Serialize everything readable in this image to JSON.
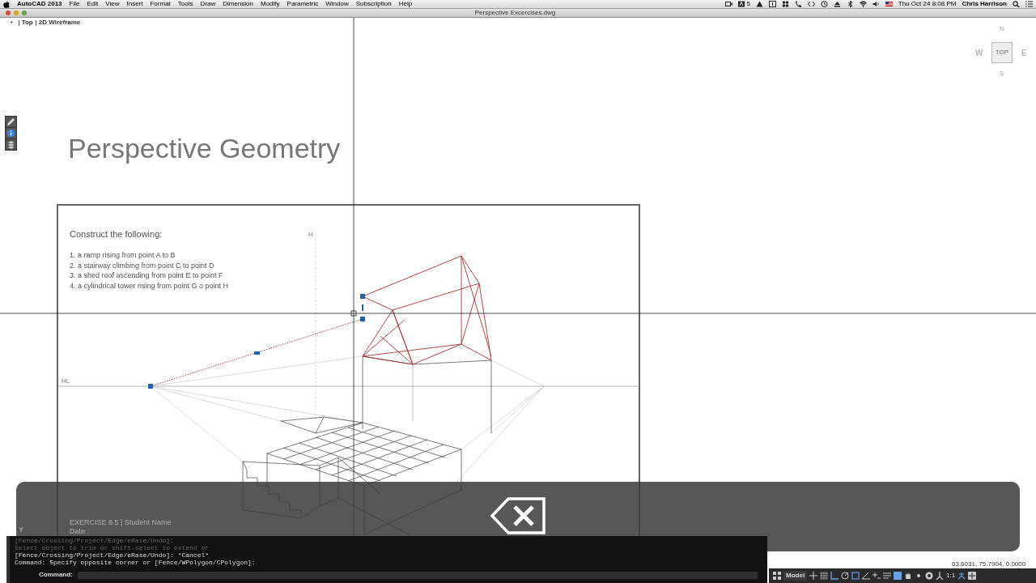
{
  "menu_bar": {
    "app": "AutoCAD 2013",
    "items": [
      "File",
      "Edit",
      "View",
      "Insert",
      "Format",
      "Tools",
      "Draw",
      "Dimension",
      "Modify",
      "Parametric",
      "Window",
      "Subscription",
      "Help"
    ],
    "adobe_count": "5",
    "clock": "Thu Oct 24  8:08 PM",
    "user": "Chris Harrison"
  },
  "window": {
    "title": "Perspective Excercises.dwg"
  },
  "viewport_controls": [
    "+",
    "Top",
    "2D Wireframe"
  ],
  "view_cube": {
    "north": "N",
    "west": "W",
    "face": "TOP",
    "east": "E",
    "south": "S"
  },
  "sheet": {
    "title": "Perspective Geometry",
    "heading": "Construct the following:",
    "tasks": [
      "1. a ramp rising from point A to B",
      "2. a stairway climbing from point C to point D",
      "3. a shed roof ascending from point E to point F",
      "4. a cylindrical tower rising from point G o point H"
    ],
    "horizon_label": "HL",
    "height_label": "H",
    "footer": [
      "EXERCISE 8.5 | Student Name",
      "Date"
    ]
  },
  "ucs_label": "Y",
  "command_line": {
    "history": [
      "[Fence/Crossing/Project/Edge/eRase/Undo]:",
      "Select object to trim or shift-select to extend or",
      "[Fence/Crossing/Project/Edge/eRase/Undo]: *Cancel*",
      "Command: Specify opposite corner or [Fence/WPolygon/CPolygon]:"
    ],
    "prompt": "Command:"
  },
  "status_bar": {
    "coordinates": "63.6031, 75.7904, 0.0000",
    "layout": "Model",
    "scale": "1:1"
  }
}
